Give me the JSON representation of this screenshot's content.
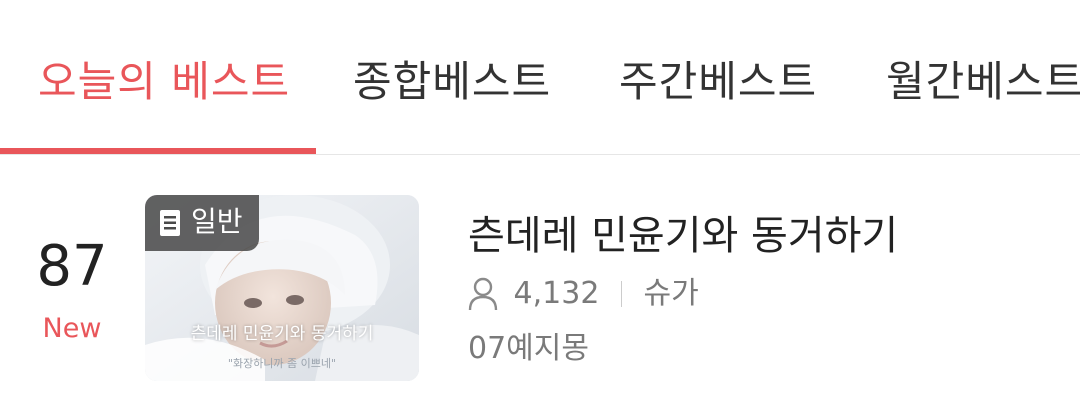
{
  "tabs": [
    {
      "label": "오늘의 베스트",
      "active": true
    },
    {
      "label": "종합베스트",
      "active": false
    },
    {
      "label": "주간베스트",
      "active": false
    },
    {
      "label": "월간베스트",
      "active": false
    }
  ],
  "accent_color": "#e9565a",
  "item": {
    "rank": "87",
    "rank_status": "New",
    "thumbnail": {
      "badge_icon": "document-icon",
      "badge_label": "일반",
      "caption": "츤데레 민윤기와 동거하기",
      "subcaption": "\"화장하니까 좀 이쁘네\""
    },
    "title": "츤데레 민윤기와 동거하기",
    "views_icon": "person-icon",
    "views": "4,132",
    "tag": "슈가",
    "author": "07예지몽"
  }
}
